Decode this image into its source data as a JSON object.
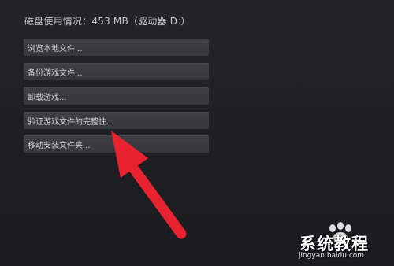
{
  "disk_usage_label": "磁盘使用情况：453 MB（驱动器 D:）",
  "buttons": [
    {
      "label": "浏览本地文件..."
    },
    {
      "label": "备份游戏文件..."
    },
    {
      "label": "卸载游戏..."
    },
    {
      "label": "验证游戏文件的完整性..."
    },
    {
      "label": "移动安装文件夹..."
    }
  ],
  "annotation": {
    "arrow_color": "#e8222e",
    "icon": "arrow-pointer-icon"
  },
  "watermark": {
    "title": "系统教程",
    "url": "jingyan.baidu.com"
  }
}
